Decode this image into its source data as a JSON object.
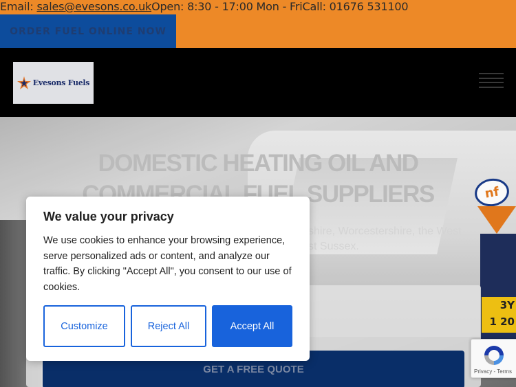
{
  "topbar": {
    "email_label": "Email: ",
    "email": "sales@evesons.co.uk",
    "hours": "Open: 8:30 - 17:00 Mon - Fri",
    "call": "Call: 01676 531100",
    "order_button": "ORDER FUEL ONLINE NOW"
  },
  "header": {
    "logo_text": "Evesons Fuels",
    "menu_icon": "hamburger-icon"
  },
  "hero": {
    "title_line1": "DOMESTIC HEATING OIL AND",
    "title_line2": "COMMERCIAL FUEL SUPPLIERS",
    "subtitle_line1": "shire, Worcestershire, the West",
    "subtitle_line2": "st Sussex.",
    "truck_logo": "nf",
    "plate_line1": "3Y",
    "plate_line2": "1 20",
    "quote_button": "GET A FREE QUOTE"
  },
  "cookie": {
    "title": "We value your privacy",
    "text": "We use cookies to enhance your browsing experience, serve personalized ads or content, and analyze our traffic. By clicking \"Accept All\", you consent to our use of cookies.",
    "customize": "Customize",
    "reject": "Reject All",
    "accept": "Accept All"
  },
  "recaptcha": {
    "text": "Privacy - Terms"
  },
  "colors": {
    "topbar_bg": "#f28c28",
    "order_button_bg": "#0e4ea0",
    "header_bg": "#000000",
    "cookie_accent": "#1863dc",
    "quote_button_bg": "#0a2f6b"
  }
}
